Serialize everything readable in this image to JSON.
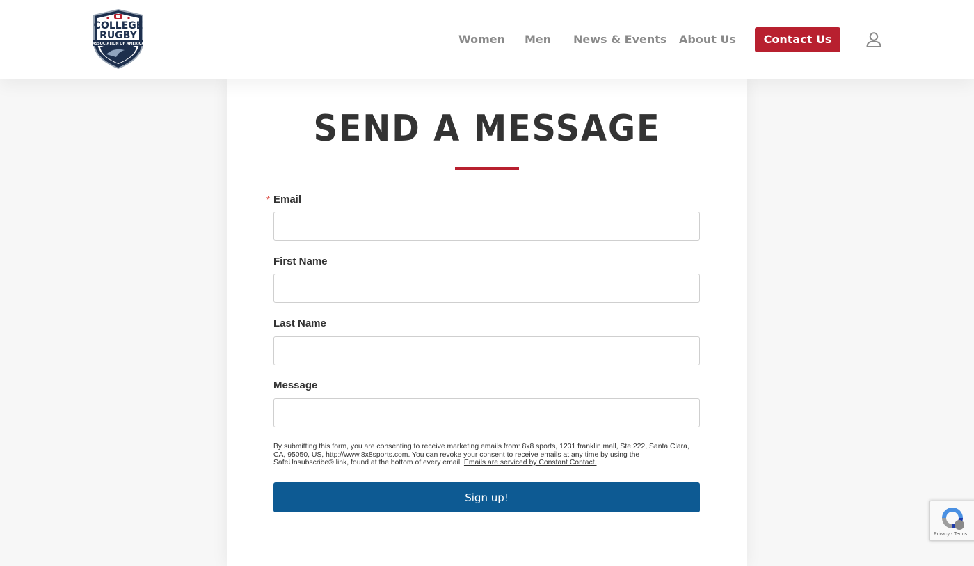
{
  "logo": {
    "line1": "COLLEGE",
    "line2": "RUGBY",
    "line3": "ASSOCIATION OF AMERICA"
  },
  "nav": {
    "items": [
      "Women",
      "Men",
      "News & Events",
      "About Us"
    ],
    "contact_label": "Contact Us",
    "account_icon": "user-icon"
  },
  "form": {
    "title": "SEND A MESSAGE",
    "required_marker": "*",
    "fields": [
      {
        "label": "Email",
        "value": "",
        "required": true
      },
      {
        "label": "First Name",
        "value": ""
      },
      {
        "label": "Last Name",
        "value": ""
      },
      {
        "label": "Message",
        "value": ""
      }
    ],
    "consent_text": "By submitting this form, you are consenting to receive marketing emails from: 8x8 sports, 1231 franklin mall, Ste 222, Santa Clara, CA, 95050, US, http://www.8x8sports.com. You can revoke your consent to receive emails at any time by using the SafeUnsubscribe® link, found at the bottom of every email.",
    "consent_link": "Emails are serviced by Constant Contact.",
    "submit_label": "Sign up!"
  },
  "recaptcha": {
    "text": "Privacy - Terms"
  },
  "colors": {
    "accent_red": "#b8202f",
    "button_blue": "#0d5a93",
    "nav_gray": "#8a8a8a",
    "title_dark": "#333333"
  }
}
